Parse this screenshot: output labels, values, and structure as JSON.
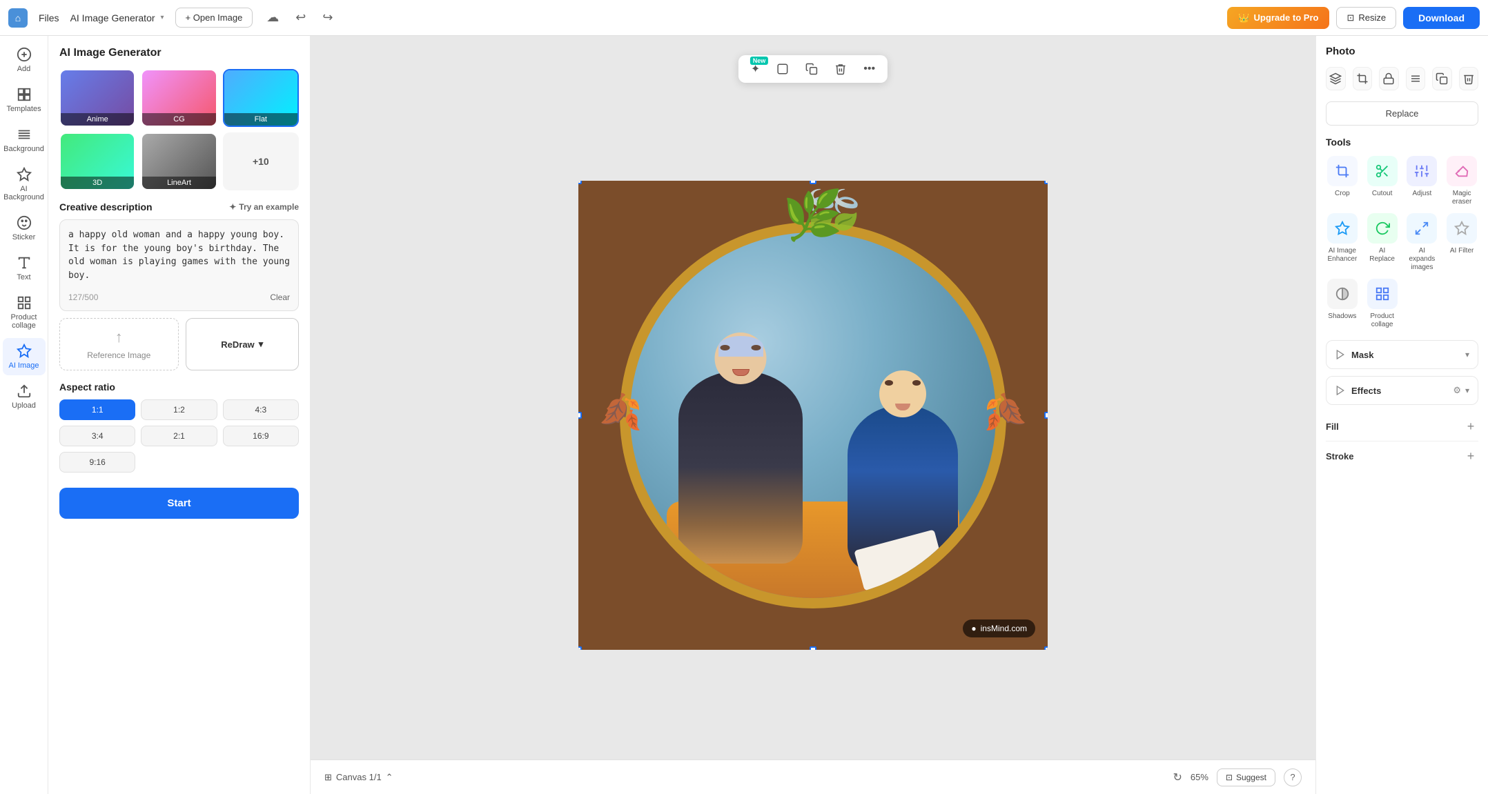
{
  "topbar": {
    "logo_char": "⌂",
    "nav_files": "Files",
    "nav_tool": "AI Image Generator",
    "open_image_label": "+ Open Image",
    "upgrade_label": "Upgrade to Pro",
    "resize_label": "Resize",
    "download_label": "Download"
  },
  "left_panel": {
    "title": "AI Image Generator",
    "styles": [
      {
        "id": "anime",
        "label": "Anime"
      },
      {
        "id": "cg",
        "label": "CG"
      },
      {
        "id": "flat",
        "label": "Flat"
      },
      {
        "id": "3d",
        "label": "3D"
      },
      {
        "id": "lineart",
        "label": "LineArt"
      }
    ],
    "more_label": "+10",
    "description_label": "Creative description",
    "try_example_label": "Try an example",
    "description_text": "a happy old woman and a happy young boy. It is for the young boy's birthday. The old woman is playing games with the young boy.",
    "char_count": "127/500",
    "clear_label": "Clear",
    "reference_image_label": "Reference Image",
    "redraw_label": "ReDraw",
    "aspect_ratio_label": "Aspect ratio",
    "aspect_options": [
      {
        "value": "1:1",
        "selected": true
      },
      {
        "value": "1:2",
        "selected": false
      },
      {
        "value": "4:3",
        "selected": false
      },
      {
        "value": "3:4",
        "selected": false
      },
      {
        "value": "2:1",
        "selected": false
      },
      {
        "value": "16:9",
        "selected": false
      },
      {
        "value": "9:16",
        "selected": false
      }
    ],
    "start_label": "Start"
  },
  "icon_sidebar": {
    "items": [
      {
        "id": "add",
        "label": "Add",
        "icon": "+"
      },
      {
        "id": "templates",
        "label": "Templates",
        "icon": "▦"
      },
      {
        "id": "background",
        "label": "Background",
        "icon": "≋"
      },
      {
        "id": "ai-background",
        "label": "AI Background",
        "icon": "✦"
      },
      {
        "id": "sticker",
        "label": "Sticker",
        "icon": "◉"
      },
      {
        "id": "text",
        "label": "Text",
        "icon": "T"
      },
      {
        "id": "product-collage",
        "label": "Product collage",
        "icon": "⊞"
      },
      {
        "id": "ai-image",
        "label": "AI Image",
        "icon": "✦"
      },
      {
        "id": "upload",
        "label": "Upload",
        "icon": "↑"
      }
    ]
  },
  "canvas": {
    "info_label": "Canvas 1/1",
    "zoom": "65%",
    "suggest_label": "Suggest",
    "watermark": "insMind.com"
  },
  "right_panel": {
    "title": "Photo",
    "replace_label": "Replace",
    "tools_title": "Tools",
    "tools": [
      {
        "id": "crop",
        "label": "Crop",
        "icon": "⊡"
      },
      {
        "id": "cutout",
        "label": "Cutout",
        "icon": "✂"
      },
      {
        "id": "adjust",
        "label": "Adjust",
        "icon": "⚙"
      },
      {
        "id": "magic-eraser",
        "label": "Magic eraser",
        "icon": "✦"
      },
      {
        "id": "ai-enhancer",
        "label": "AI Image Enhancer",
        "icon": "✦"
      },
      {
        "id": "ai-replace",
        "label": "AI Replace",
        "icon": "✂"
      },
      {
        "id": "ai-expands",
        "label": "AI expands images",
        "icon": "⤢"
      },
      {
        "id": "ai-filter",
        "label": "AI Filter",
        "icon": "◈"
      },
      {
        "id": "shadows",
        "label": "Shadows",
        "icon": "◑"
      },
      {
        "id": "product-collage",
        "label": "Product collage",
        "icon": "⊞"
      }
    ],
    "mask_label": "Mask",
    "effects_label": "Effects",
    "fill_label": "Fill",
    "stroke_label": "Stroke"
  }
}
